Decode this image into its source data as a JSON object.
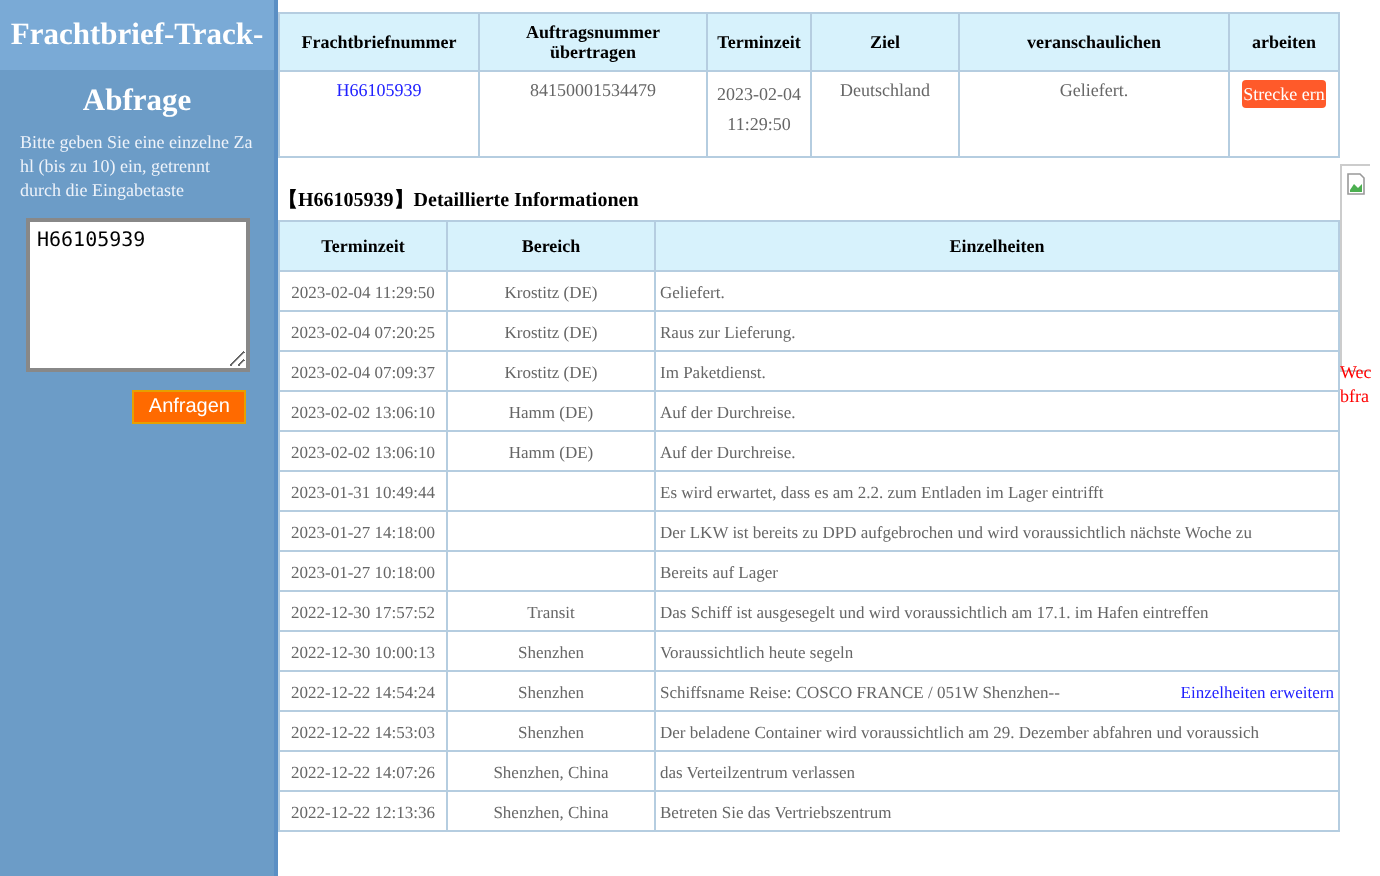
{
  "sidebar": {
    "title_line_1": "Frachtbrief-Track-",
    "title_line_2": "Abfrage",
    "hint": "Bitte geben Sie eine einzelne Za hl (bis zu 10) ein, getrennt durch die Eingabetaste",
    "input_value": "H66105939",
    "button": "Anfragen"
  },
  "summary_table": {
    "columns": [
      "Frachtbriefnummer",
      "Auftragsnummer übertragen",
      "Terminzeit",
      "Ziel",
      "veranschaulichen",
      "arbeiten"
    ],
    "rows": [
      {
        "waybill": "H66105939",
        "order_number": "84150001534479",
        "time": "2023-02-04 11:29:50",
        "destination": "Deutschland",
        "status": "Geliefert.",
        "action": "Strecke ern"
      }
    ]
  },
  "details": {
    "title": "【H66105939】Detaillierte Informationen",
    "columns": [
      "Terminzeit",
      "Bereich",
      "Einzelheiten"
    ],
    "rows": [
      {
        "time": "2023-02-04 11:29:50",
        "area": "Krostitz (DE)",
        "detail": "Geliefert."
      },
      {
        "time": "2023-02-04 07:20:25",
        "area": "Krostitz (DE)",
        "detail": "Raus zur Lieferung."
      },
      {
        "time": "2023-02-04 07:09:37",
        "area": "Krostitz (DE)",
        "detail": "Im Paketdienst."
      },
      {
        "time": "2023-02-02 13:06:10",
        "area": "Hamm (DE)",
        "detail": "Auf der Durchreise."
      },
      {
        "time": "2023-02-02 13:06:10",
        "area": "Hamm (DE)",
        "detail": "Auf der Durchreise."
      },
      {
        "time": "2023-01-31 10:49:44",
        "area": "",
        "detail": "Es wird erwartet, dass es am 2.2. zum Entladen im Lager eintrifft"
      },
      {
        "time": "2023-01-27 14:18:00",
        "area": "",
        "detail": "Der LKW ist bereits zu DPD aufgebrochen und wird voraussichtlich nächste Woche zu"
      },
      {
        "time": "2023-01-27 10:18:00",
        "area": "",
        "detail": "Bereits auf Lager"
      },
      {
        "time": "2022-12-30 17:57:52",
        "area": "Transit",
        "detail": "Das Schiff ist ausgesegelt und wird voraussichtlich am 17.1. im Hafen eintreffen"
      },
      {
        "time": "2022-12-30 10:00:13",
        "area": "Shenzhen",
        "detail": "Voraussichtlich heute segeln"
      },
      {
        "time": "2022-12-22 14:54:24",
        "area": "Shenzhen",
        "detail": "Schiffsname Reise: COSCO FRANCE / 051W Shenzhen--",
        "link": "Einzelheiten erweitern"
      },
      {
        "time": "2022-12-22 14:53:03",
        "area": "Shenzhen",
        "detail": "Der beladene Container wird voraussichtlich am 29. Dezember abfahren und voraussich"
      },
      {
        "time": "2022-12-22 14:07:26",
        "area": "Shenzhen, China",
        "detail": "das Verteilzentrum verlassen"
      },
      {
        "time": "2022-12-22 12:13:36",
        "area": "Shenzhen, China",
        "detail": "Betreten Sie das Vertriebszentrum"
      }
    ]
  },
  "side_note": [
    "Wec",
    "bfra"
  ]
}
